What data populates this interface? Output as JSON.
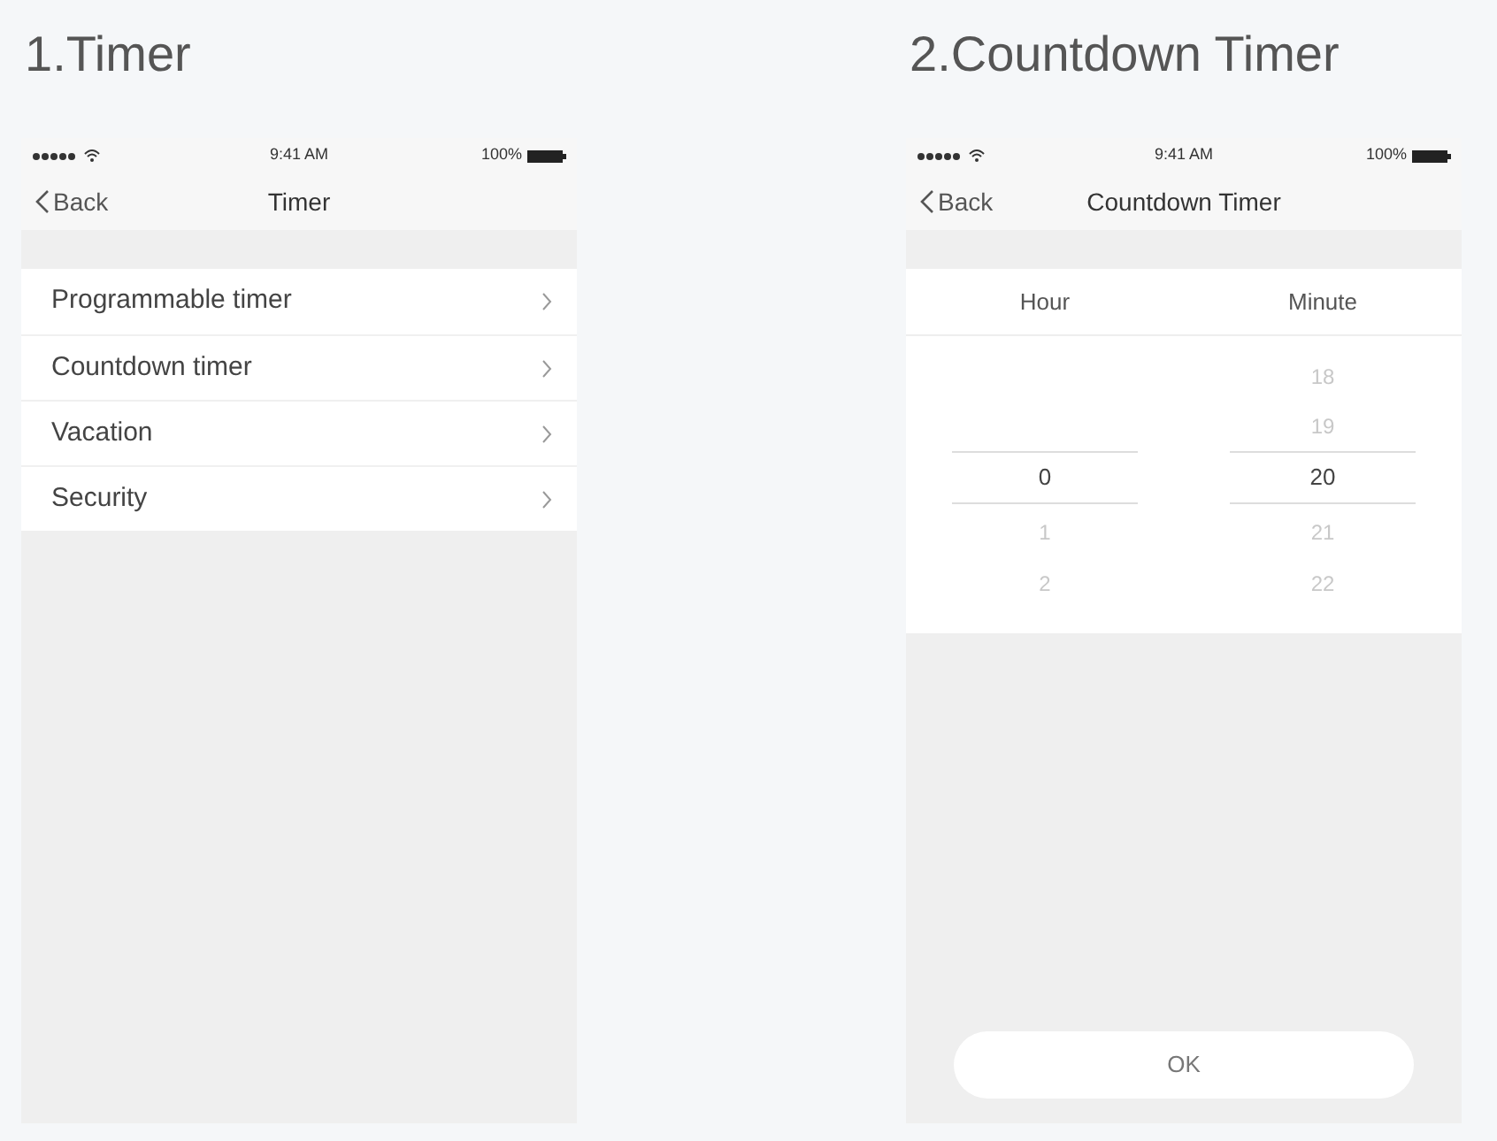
{
  "screens": [
    {
      "heading": "1.Timer",
      "kind": "menu",
      "status_bar": {
        "time": "9:41 AM",
        "battery": "100%"
      },
      "nav": {
        "back": "Back",
        "title": "Timer"
      },
      "items": [
        {
          "label": "Programmable timer"
        },
        {
          "label": "Countdown timer"
        },
        {
          "label": "Vacation"
        },
        {
          "label": "Security"
        }
      ]
    },
    {
      "heading": "2.Countdown Timer",
      "kind": "picker",
      "status_bar": {
        "time": "9:41 AM",
        "battery": "100%"
      },
      "nav": {
        "back": "Back",
        "title": "Countdown Timer"
      },
      "columns": [
        {
          "label": "Hour",
          "values": [
            {
              "text": "0",
              "selected": true
            },
            {
              "text": "1",
              "selected": false
            },
            {
              "text": "2",
              "selected": false
            }
          ]
        },
        {
          "label": "Minute",
          "values": [
            {
              "text": "18",
              "selected": false
            },
            {
              "text": "19",
              "selected": false
            },
            {
              "text": "20",
              "selected": true
            },
            {
              "text": "21",
              "selected": false
            },
            {
              "text": "22",
              "selected": false
            }
          ]
        }
      ],
      "button": "OK"
    }
  ]
}
